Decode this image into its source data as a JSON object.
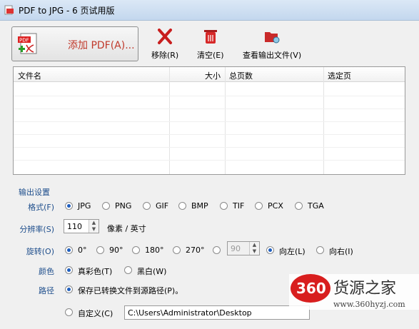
{
  "window": {
    "title": "PDF to JPG - 6 页试用版"
  },
  "toolbar": {
    "add_label": "添加 PDF(A)...",
    "remove_label": "移除(R)",
    "clear_label": "清空(E)",
    "view_output_label": "查看输出文件(V)"
  },
  "filelist": {
    "columns": [
      "文件名",
      "大小",
      "总页数",
      "选定页"
    ]
  },
  "settings": {
    "group_title": "输出设置",
    "format": {
      "label": "格式(F)",
      "options": [
        "JPG",
        "PNG",
        "GIF",
        "BMP",
        "TIF",
        "PCX",
        "TGA"
      ],
      "selected": "JPG"
    },
    "resolution": {
      "label": "分辨率(S)",
      "value": "110",
      "unit": "像素 / 英寸"
    },
    "rotation": {
      "label": "旋转(O)",
      "options": [
        "0°",
        "90°",
        "180°",
        "270°"
      ],
      "selected": "0°",
      "custom_value": "90",
      "direction_left": "向左(L)",
      "direction_right": "向右(I)",
      "direction_selected": "向左(L)"
    },
    "color": {
      "label": "颜色",
      "options": [
        "真彩色(T)",
        "黑白(W)"
      ],
      "selected": "真彩色(T)"
    },
    "path": {
      "label": "路径",
      "keep_source": "保存已转换文件到源路径(P)。",
      "custom": "自定义(C)",
      "custom_value": "C:\\Users\\Administrator\\Desktop"
    }
  },
  "watermark": {
    "brand_number": "360",
    "brand_text": "货源之家",
    "url": "www.360hyzj.com"
  }
}
